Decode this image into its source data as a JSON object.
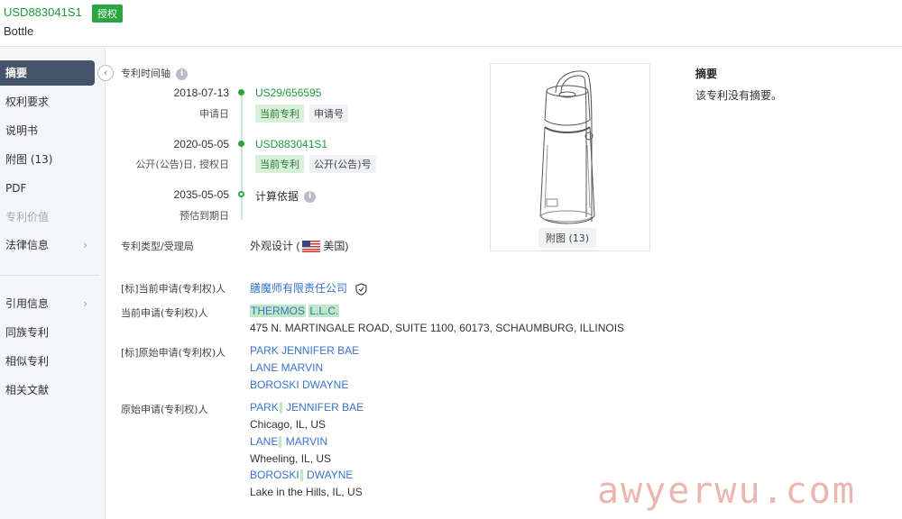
{
  "header": {
    "patent_number": "USD883041S1",
    "status_badge": "授权",
    "title": "Bottle"
  },
  "sidebar": {
    "items": [
      {
        "label": "摘要",
        "state": "active"
      },
      {
        "label": "权利要求"
      },
      {
        "label": "说明书"
      },
      {
        "label": "附图 (13)"
      },
      {
        "label": "PDF"
      },
      {
        "label": "专利价值",
        "state": "disabled"
      },
      {
        "label": "法律信息",
        "chevron": true
      },
      {
        "label": "引用信息",
        "chevron": true
      },
      {
        "label": "同族专利"
      },
      {
        "label": "相似专利"
      },
      {
        "label": "相关文献"
      }
    ]
  },
  "timeline": {
    "title": "专利时间轴",
    "events": [
      {
        "date": "2018-07-13",
        "sub": "申请日",
        "value": "US29/656595",
        "tags": [
          "当前专利",
          "申请号"
        ]
      },
      {
        "date": "2020-05-05",
        "sub": "公开(公告)日, 授权日",
        "value": "USD883041S1",
        "tags": [
          "当前专利",
          "公开(公告)号"
        ]
      },
      {
        "date": "2035-05-05",
        "sub": "预估到期日",
        "value": "计算依据"
      }
    ]
  },
  "image_panel": {
    "caption": "附图 (13)"
  },
  "abstract": {
    "title": "摘要",
    "text": "该专利没有摘要。"
  },
  "info": {
    "type_label": "专利类型/受理局",
    "type_value": "外观设计",
    "country": "美国",
    "std_applicant_label": "[标]当前申请(专利权)人",
    "std_applicant": "膳魔师有限责任公司",
    "cur_applicant_label": "当前申请(专利权)人",
    "cur_applicant_name_a": "THERMOS",
    "cur_applicant_name_b": "L.L.C.",
    "cur_applicant_address": "475 N. MARTINGALE ROAD, SUITE 1100, 60173, SCHAUMBURG, ILLINOIS",
    "std_orig_label": "[标]原始申请(专利权)人",
    "std_orig": [
      "PARK JENNIFER BAE",
      "LANE MARVIN",
      "BOROSKI DWAYNE"
    ],
    "orig_label": "原始申请(专利权)人",
    "orig": [
      {
        "first": "PARK",
        "rest": "JENNIFER BAE",
        "location": "Chicago, IL, US"
      },
      {
        "first": "LANE",
        "rest": "MARVIN",
        "location": "Wheeling, IL, US"
      },
      {
        "first": "BOROSKI",
        "rest": "DWAYNE",
        "location": "Lake in the Hills, IL, US"
      }
    ]
  },
  "watermark": "awyerwu.com",
  "colors": {
    "accent_green": "#1c9b3a",
    "link_blue": "#3a73c9",
    "sidebar_active": "#46546b"
  }
}
